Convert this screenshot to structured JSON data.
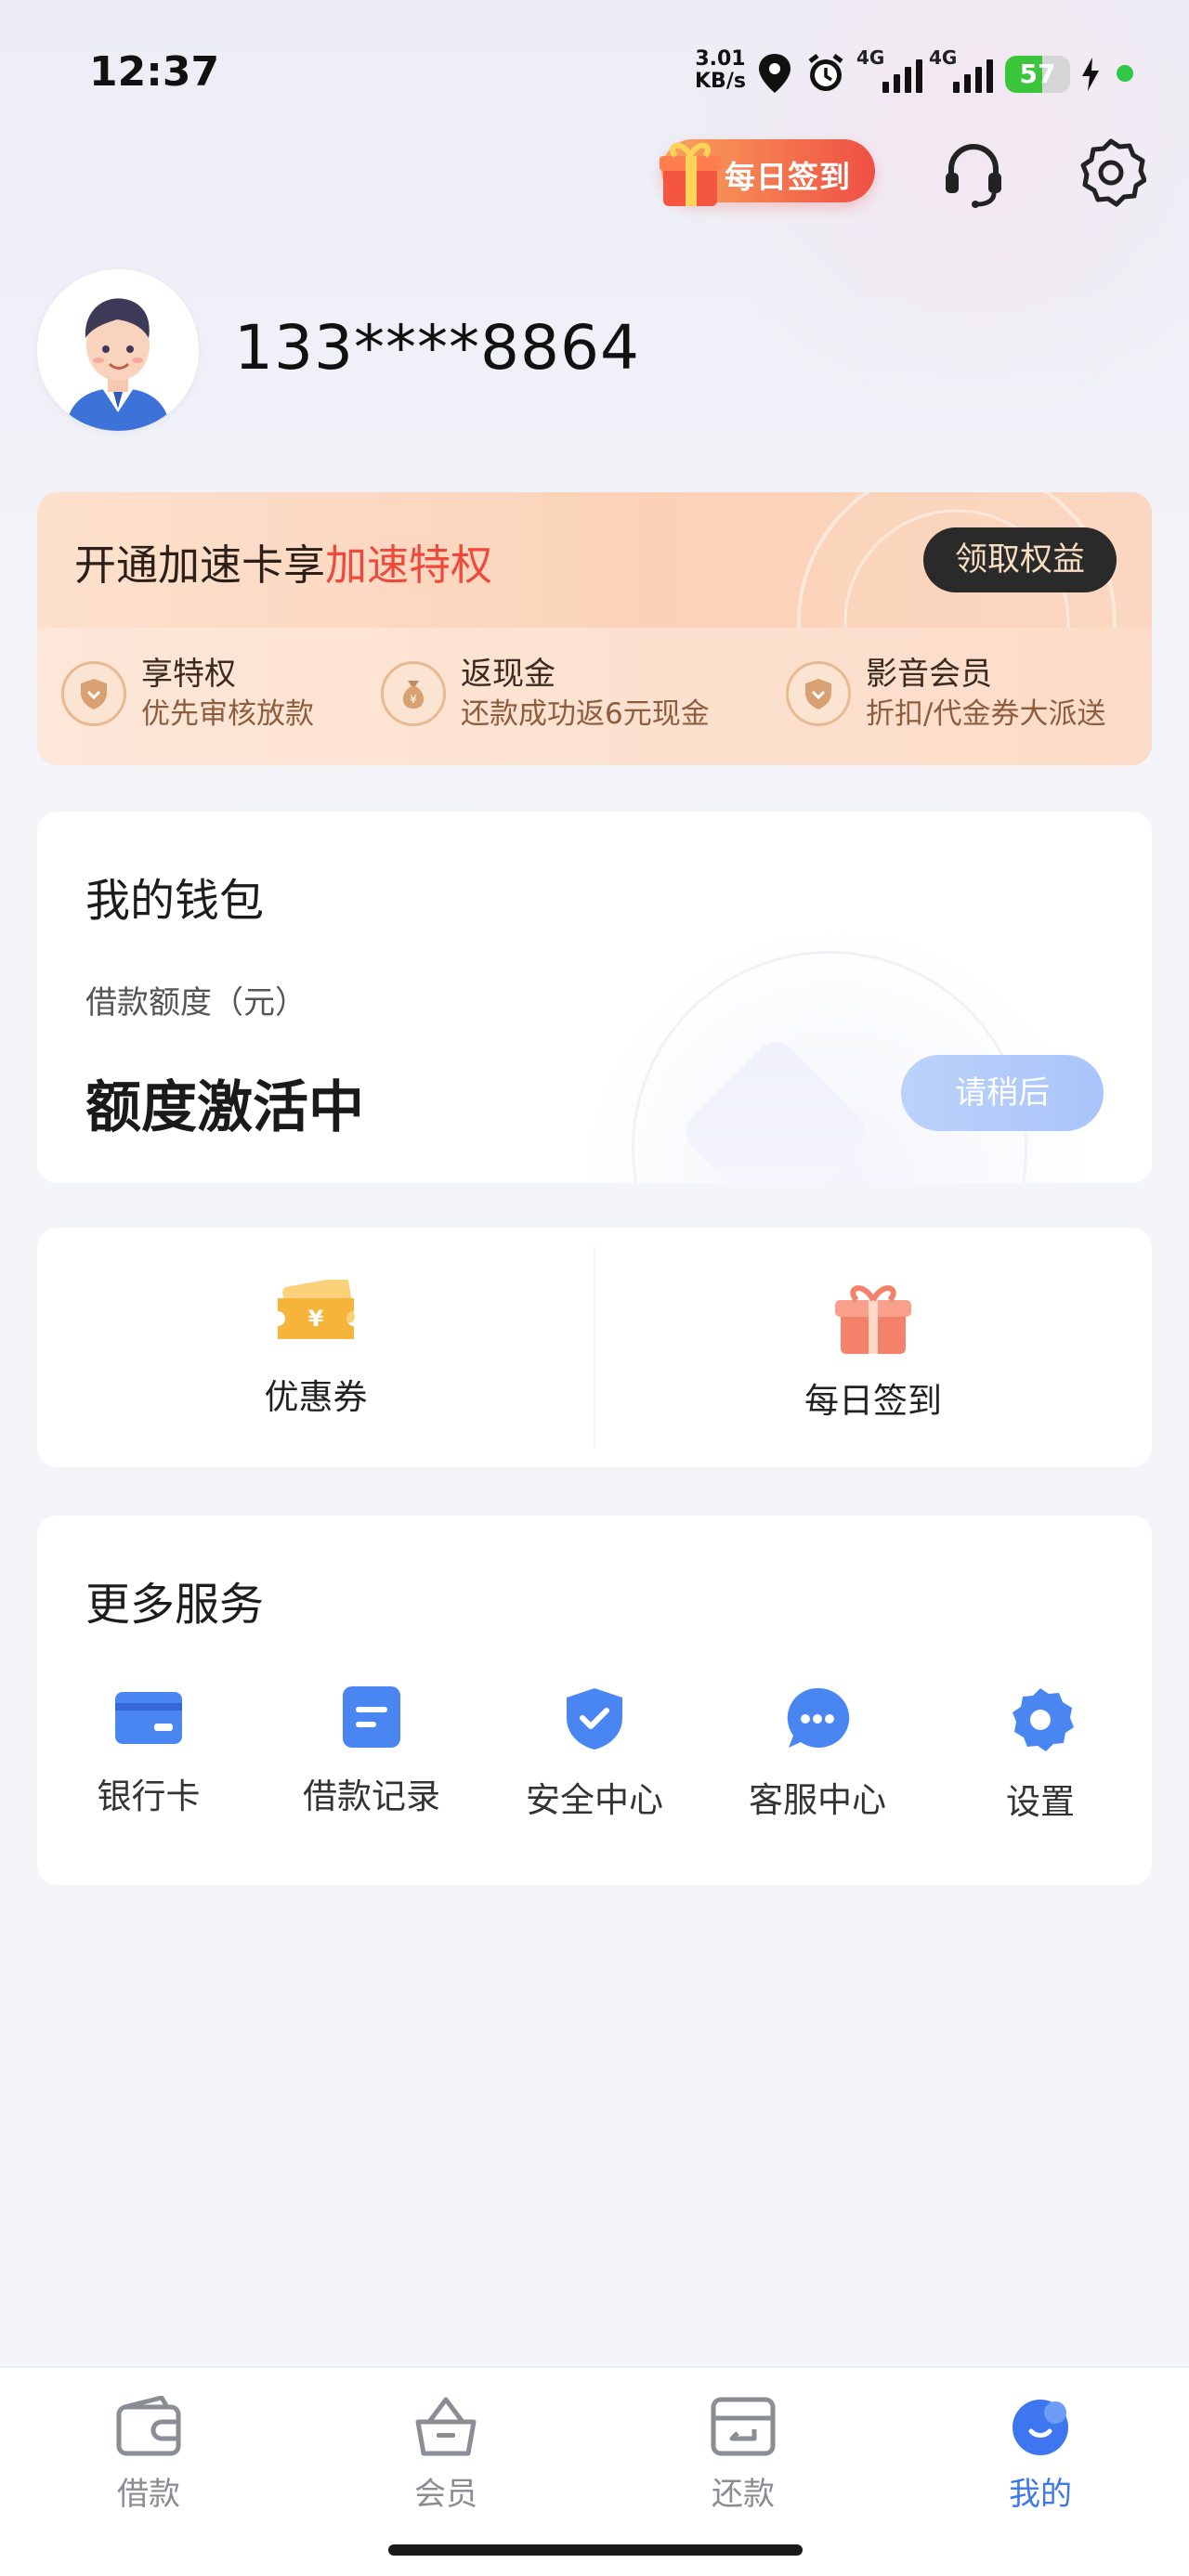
{
  "status_bar": {
    "time": "12:37",
    "net_speed_value": "3.01",
    "net_speed_unit": "KB/s",
    "sim1": "4G",
    "sim2": "4G",
    "battery": "57"
  },
  "header": {
    "signin_label": "每日签到",
    "headset_icon": "headset-icon",
    "settings_icon": "gear-icon"
  },
  "profile": {
    "phone": "133****8864"
  },
  "vip_card": {
    "title_prefix": "开通加速卡享",
    "title_highlight": "加速特权",
    "button": "领取权益",
    "perks": [
      {
        "title": "享特权",
        "subtitle": "优先审核放款",
        "icon": "heart-shield-icon"
      },
      {
        "title": "返现金",
        "subtitle": "还款成功返6元现金",
        "icon": "money-bag-icon"
      },
      {
        "title": "影音会员",
        "subtitle": "折扣/代金券大派送",
        "icon": "heart-shield-icon"
      }
    ]
  },
  "wallet": {
    "title": "我的钱包",
    "limit_label": "借款额度（元）",
    "limit_value": "额度激活中",
    "button": "请稍后"
  },
  "quick_actions": [
    {
      "label": "优惠券",
      "icon": "coupon-icon"
    },
    {
      "label": "每日签到",
      "icon": "gift-icon"
    }
  ],
  "services": {
    "title": "更多服务",
    "items": [
      {
        "label": "银行卡",
        "icon": "bank-card-icon"
      },
      {
        "label": "借款记录",
        "icon": "record-icon"
      },
      {
        "label": "安全中心",
        "icon": "shield-check-icon"
      },
      {
        "label": "客服中心",
        "icon": "chat-bubble-icon"
      },
      {
        "label": "设置",
        "icon": "settings-gear-icon"
      }
    ]
  },
  "bottom_nav": [
    {
      "label": "借款",
      "icon": "wallet-icon",
      "active": false
    },
    {
      "label": "会员",
      "icon": "basket-icon",
      "active": false
    },
    {
      "label": "还款",
      "icon": "repay-card-icon",
      "active": false
    },
    {
      "label": "我的",
      "icon": "smile-icon",
      "active": true
    }
  ],
  "colors": {
    "accent_blue": "#3e76f0",
    "vip_highlight": "#ee4a3c",
    "icon_blue": "#4a86f2"
  }
}
